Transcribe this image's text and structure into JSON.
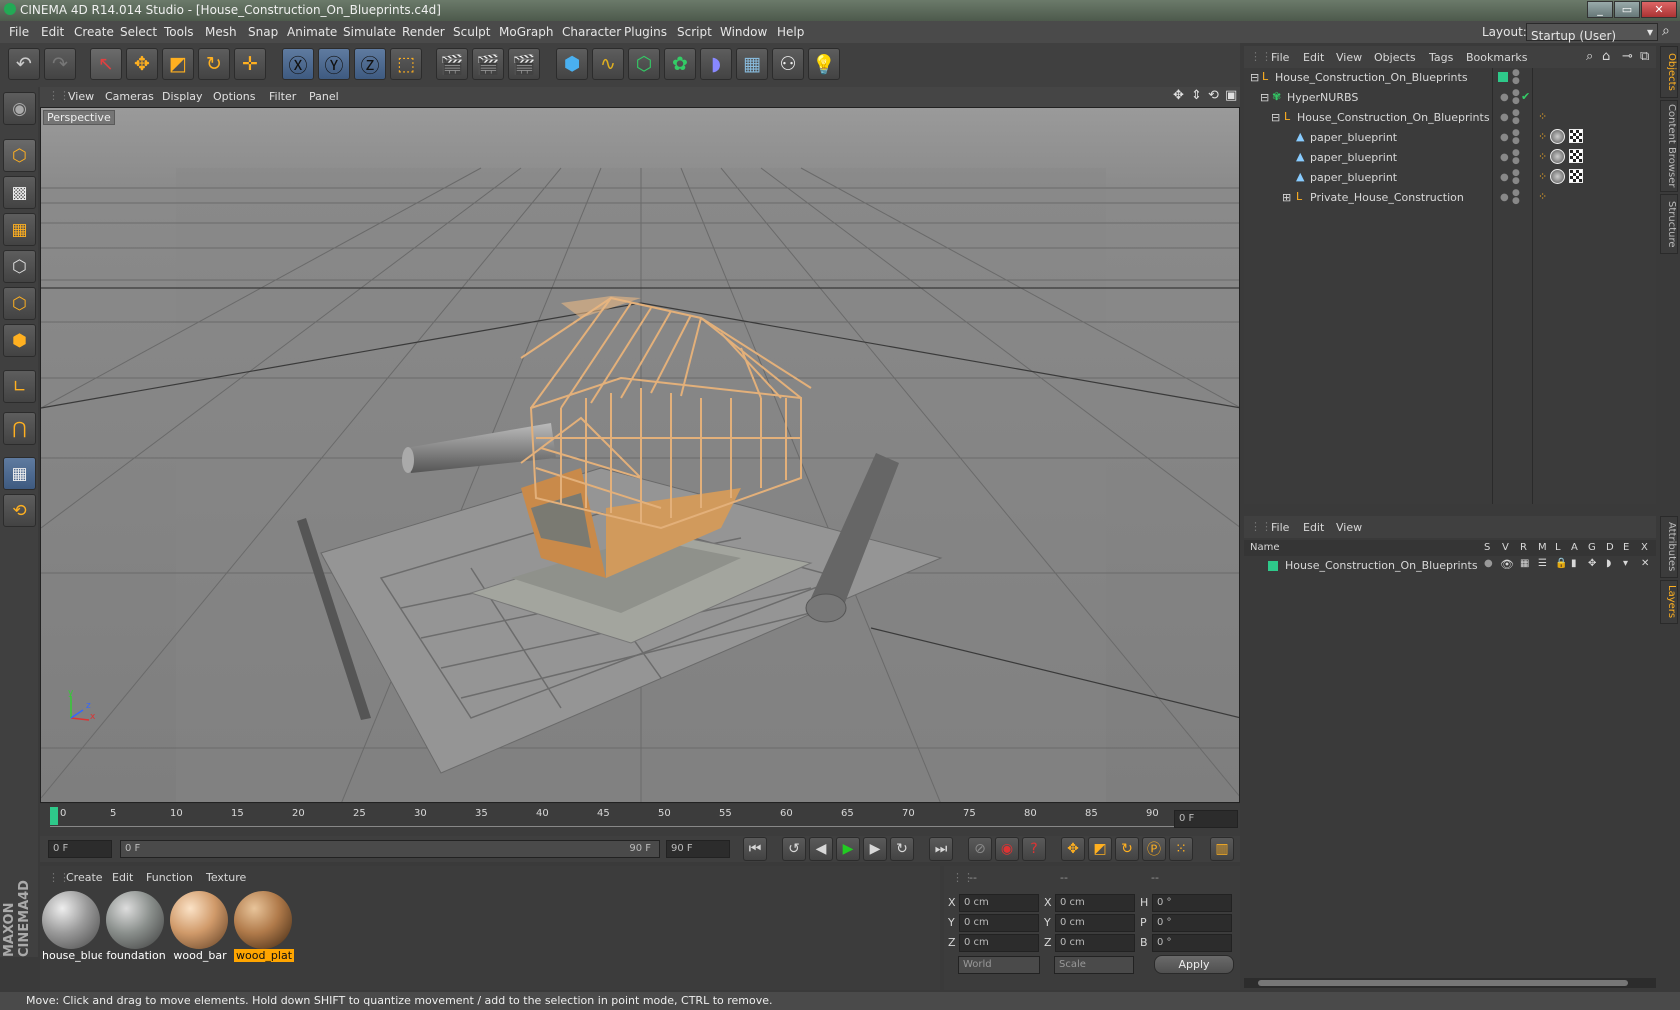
{
  "window": {
    "title": "CINEMA 4D R14.014 Studio - [House_Construction_On_Blueprints.c4d]",
    "layout_label": "Layout:",
    "layout_value": "Startup (User)"
  },
  "menu": [
    "File",
    "Edit",
    "Create",
    "Select",
    "Tools",
    "Mesh",
    "Snap",
    "Animate",
    "Simulate",
    "Render",
    "Sculpt",
    "MoGraph",
    "Character",
    "Plugins",
    "Script",
    "Window",
    "Help"
  ],
  "viewport": {
    "menu": [
      "View",
      "Cameras",
      "Display",
      "Options",
      "Filter",
      "Panel"
    ],
    "label": "Perspective",
    "axis_x": "x",
    "axis_y": "y",
    "axis_z": "z"
  },
  "timeline": {
    "ticks": [
      "0",
      "5",
      "10",
      "15",
      "20",
      "25",
      "30",
      "35",
      "40",
      "45",
      "50",
      "55",
      "60",
      "65",
      "70",
      "75",
      "80",
      "85",
      "90"
    ],
    "current_frame": "0 F",
    "start_field": "0 F",
    "range_start": "0 F",
    "range_end": "90 F",
    "end_field": "90 F"
  },
  "materials": {
    "menu": [
      "Create",
      "Edit",
      "Function",
      "Texture"
    ],
    "items": [
      {
        "name": "house_blue",
        "color": "#9a9a9a"
      },
      {
        "name": "foundation",
        "color": "#8a8f8c"
      },
      {
        "name": "wood_bar",
        "color": "#d09a6a"
      },
      {
        "name": "wood_plat",
        "color": "#b07a4a"
      }
    ]
  },
  "coords": {
    "headers": [
      "--",
      "--",
      "--"
    ],
    "rows": [
      {
        "a": "X",
        "av": "0 cm",
        "b": "X",
        "bv": "0 cm",
        "c": "H",
        "cv": "0 °"
      },
      {
        "a": "Y",
        "av": "0 cm",
        "b": "Y",
        "bv": "0 cm",
        "c": "P",
        "cv": "0 °"
      },
      {
        "a": "Z",
        "av": "0 cm",
        "b": "Z",
        "bv": "0 cm",
        "c": "B",
        "cv": "0 °"
      }
    ],
    "space": "World",
    "mode": "Scale",
    "apply": "Apply"
  },
  "objects": {
    "menu": [
      "File",
      "Edit",
      "View",
      "Objects",
      "Tags",
      "Bookmarks"
    ],
    "rows": [
      {
        "name": "House_Construction_On_Blueprints",
        "indent": 0
      },
      {
        "name": "HyperNURBS",
        "indent": 1
      },
      {
        "name": "House_Construction_On_Blueprints",
        "indent": 2
      },
      {
        "name": "paper_blueprint",
        "indent": 3
      },
      {
        "name": "paper_blueprint",
        "indent": 3
      },
      {
        "name": "paper_blueprint",
        "indent": 3
      },
      {
        "name": "Private_House_Construction",
        "indent": 3
      }
    ]
  },
  "layers": {
    "menu": [
      "File",
      "Edit",
      "View"
    ],
    "name_header": "Name",
    "flags": [
      "S",
      "V",
      "R",
      "M",
      "L",
      "A",
      "G",
      "D",
      "E",
      "X"
    ],
    "row": "House_Construction_On_Blueprints"
  },
  "side_tabs": [
    "Objects",
    "Content Browser",
    "Structure",
    "Attributes",
    "Layers"
  ],
  "status": "Move: Click and drag to move elements. Hold down SHIFT to quantize movement / add to the selection in point mode, CTRL to remove.",
  "colors": {
    "accent": "#ffa500",
    "layer_green": "#2ec98a"
  }
}
